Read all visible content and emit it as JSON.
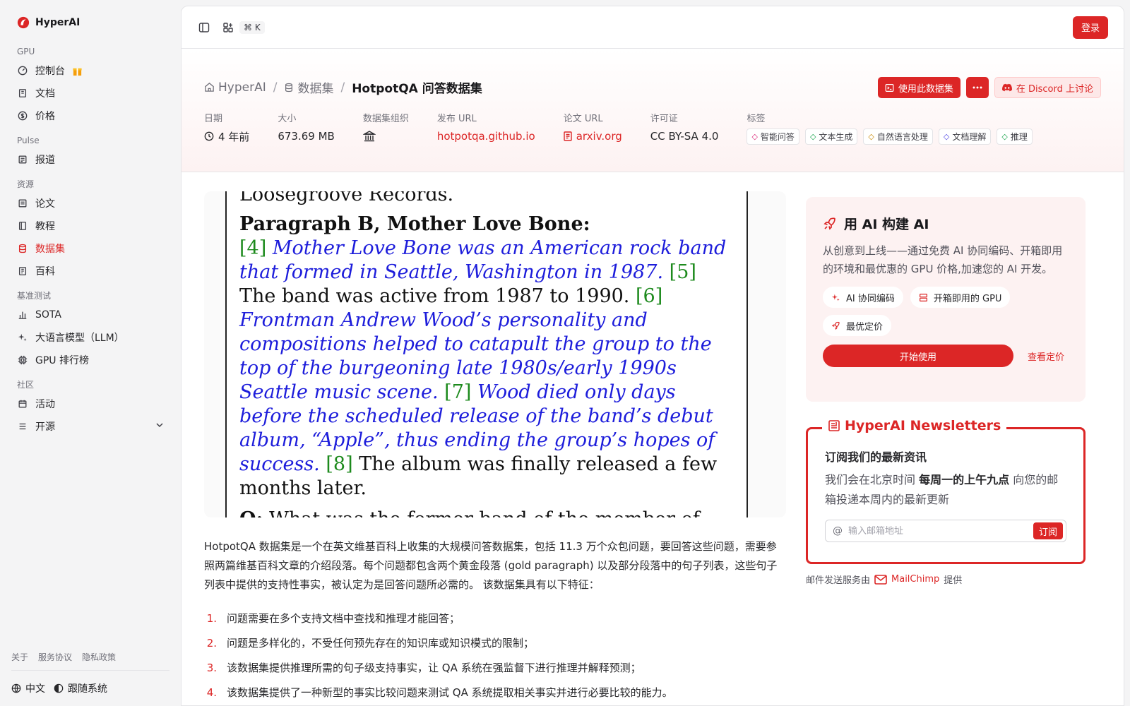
{
  "brand": {
    "name": "HyperAI",
    "accent": "#dc2626"
  },
  "sidebar": {
    "sections": [
      {
        "label": "GPU",
        "items": [
          {
            "label": "控制台",
            "icon": "gauge-icon",
            "badge": "gift-icon"
          },
          {
            "label": "文档",
            "icon": "book-icon"
          },
          {
            "label": "价格",
            "icon": "dollar-icon"
          }
        ]
      },
      {
        "label": "Pulse",
        "items": [
          {
            "label": "报道",
            "icon": "newspaper-icon"
          }
        ]
      },
      {
        "label": "资源",
        "items": [
          {
            "label": "论文",
            "icon": "document-icon"
          },
          {
            "label": "教程",
            "icon": "notebook-icon"
          },
          {
            "label": "数据集",
            "icon": "database-icon",
            "active": true
          },
          {
            "label": "百科",
            "icon": "encyclopedia-icon"
          }
        ]
      },
      {
        "label": "基准测试",
        "items": [
          {
            "label": "SOTA",
            "icon": "bar-chart-icon"
          },
          {
            "label": "大语言模型（LLM）",
            "icon": "sparkles-icon"
          },
          {
            "label": "GPU 排行榜",
            "icon": "cpu-icon"
          }
        ]
      },
      {
        "label": "社区",
        "items": [
          {
            "label": "活动",
            "icon": "calendar-icon"
          },
          {
            "label": "开源",
            "icon": "list-icon",
            "expandable": true
          }
        ]
      }
    ],
    "footer_links": [
      "关于",
      "服务协议",
      "隐私政策"
    ],
    "language": "中文",
    "theme": "跟随系统"
  },
  "topbar": {
    "shortcut": "⌘ K",
    "login": "登录"
  },
  "breadcrumb": {
    "home": "HyperAI",
    "section": "数据集",
    "current": "HotpotQA 问答数据集"
  },
  "actions": {
    "use": "使用此数据集",
    "discord": "在 Discord 上讨论"
  },
  "meta": {
    "date_label": "日期",
    "date": "4 年前",
    "size_label": "大小",
    "size": "673.69 MB",
    "org_label": "数据集组织",
    "url_label": "发布 URL",
    "url": "hotpotqa.github.io",
    "paper_label": "论文 URL",
    "paper": "arxiv.org",
    "license_label": "许可证",
    "license": "CC BY-SA 4.0",
    "tags_label": "标签",
    "tags": [
      {
        "label": "智能问答",
        "color": "#db2777"
      },
      {
        "label": "文本生成",
        "color": "#16a34a"
      },
      {
        "label": "自然语言处理",
        "color": "#ca8a04"
      },
      {
        "label": "文档理解",
        "color": "#4f46e5"
      },
      {
        "label": "推理",
        "color": "#16a34a"
      }
    ]
  },
  "figure": {
    "top_line": "Loosegroove Records.",
    "heading": "Paragraph B, Mother Love Bone:",
    "s4_num": "[4]",
    "s4": "Mother Love Bone was an American rock band that formed in Seattle, Washington in 1987.",
    "s5_num": "[5]",
    "s5": "The band was active from 1987 to 1990.",
    "s6_num": "[6]",
    "s6": "Frontman Andrew Wood’s personality and compositions helped to catapult the group to the top of the burgeoning late 1980s/early 1990s Seattle music scene.",
    "s7_num": "[7]",
    "s7": "Wood died only days before the scheduled release of the band’s debut album, “Apple”, thus ending the group’s hopes of success.",
    "s8_num": "[8]",
    "s8": "The album was finally released a few months later.",
    "q_label": "Q:",
    "q": "What was the former band of the member of Mother Love Bone who died just before the release of “Apple”?"
  },
  "description": "HotpotQA 数据集是一个在英文维基百科上收集的大规模问答数据集，包括 11.3 万个众包问题，要回答这些问题，需要参照两篇维基百科文章的介绍段落。每个问题都包含两个黄金段落 (gold paragraph) 以及部分段落中的句子列表，这些句子列表中提供的支持性事实，被认定为是回答问题所必需的。 该数据集具有以下特征：",
  "features": [
    {
      "num": "1.",
      "text": "问题需要在多个支持文档中查找和推理才能回答；"
    },
    {
      "num": "2.",
      "text": "问题是多样化的，不受任何预先存在的知识库或知识模式的限制；"
    },
    {
      "num": "3.",
      "text": "该数据集提供推理所需的句子级支持事实，让 QA 系统在强监督下进行推理并解释预测；"
    },
    {
      "num": "4.",
      "text": "该数据集提供了一种新型的事实比较问题来测试 QA 系统提取相关事实并进行必要比较的能力。"
    }
  ],
  "promo": {
    "title": "用 AI 构建 AI",
    "desc": "从创意到上线——通过免费 AI 协同编码、开箱即用的环境和最优惠的 GPU 价格,加速您的 AI 开发。",
    "chips": [
      "AI 协同编码",
      "开箱即用的 GPU",
      "最优定价"
    ],
    "start": "开始使用",
    "pricing": "查看定价"
  },
  "newsletter": {
    "legend": "HyperAI Newsletters",
    "title": "订阅我们的最新资讯",
    "desc_pre": "我们会在北京时间 ",
    "desc_bold": "每周一的上午九点",
    "desc_post": " 向您的邮箱投递本周内的最新更新",
    "placeholder": "输入邮箱地址",
    "subscribe": "订阅",
    "credit_pre": "邮件发送服务由",
    "credit_brand": "MailChimp",
    "credit_post": "提供"
  }
}
